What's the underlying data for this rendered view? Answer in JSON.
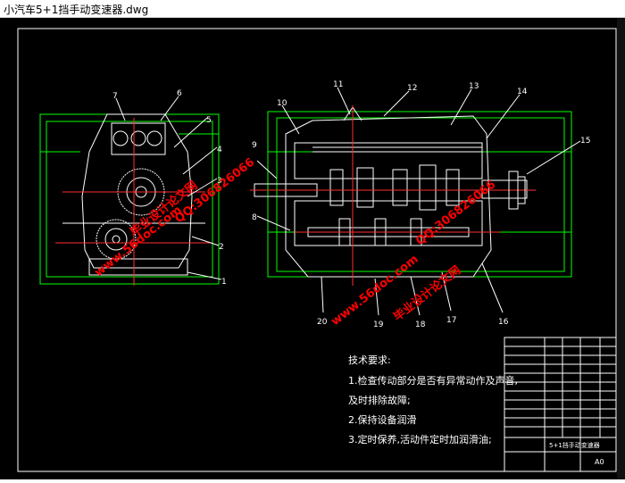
{
  "window": {
    "title": "小汽车5+1挡手动变速器.dwg"
  },
  "drawing": {
    "callouts_left": [
      "7",
      "6",
      "5",
      "4",
      "3",
      "2",
      "1"
    ],
    "callouts_right": [
      "10",
      "11",
      "12",
      "13",
      "14",
      "15",
      "8",
      "9",
      "20",
      "19",
      "18",
      "17",
      "16"
    ],
    "tech_requirements": {
      "heading": "技术要求:",
      "line1": "1.检查传动部分是否有异常动作及声音,",
      "line2": "及时排除故障;",
      "line3": "2.保持设备润滑",
      "line4": "3.定时保养,活动件定时加润滑油;"
    },
    "title_block": {
      "name": "5+1挡手动变速器",
      "sheet": "A0"
    },
    "watermarks": {
      "site": "www.56doc.com",
      "name": "毕业设计论文网",
      "qq": "QQ:306826066"
    },
    "colors": {
      "background": "#000000",
      "outline": "#ffffff",
      "section": "#00ff00",
      "dim": "#ff3030",
      "watermark": "#ff0000"
    }
  }
}
